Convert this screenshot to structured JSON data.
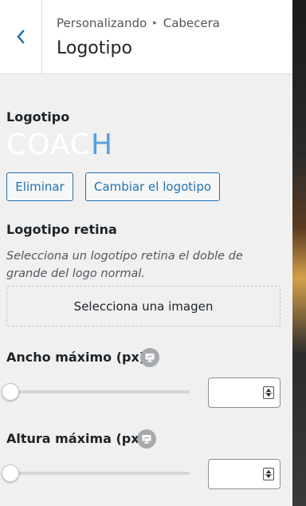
{
  "header": {
    "breadcrumb_parent": "Personalizando",
    "breadcrumb_separator": "▸",
    "breadcrumb_current": "Cabecera",
    "title": "Logotipo"
  },
  "logo": {
    "label": "Logotipo",
    "preview_text_main": "COAC",
    "preview_text_accent": "H",
    "remove_button": "Eliminar",
    "change_button": "Cambiar el logotipo"
  },
  "retina": {
    "label": "Logotipo retina",
    "description": "Selecciona un logotipo retina el doble de grande del logo normal.",
    "select_button": "Selecciona una imagen"
  },
  "max_width": {
    "label": "Ancho máximo (px)",
    "slider_value": 0,
    "input_value": ""
  },
  "max_height": {
    "label": "Altura máxima (px)",
    "slider_value": 0,
    "input_value": ""
  },
  "colors": {
    "accent": "#2271b1",
    "logo_accent": "#5b9fe0"
  }
}
